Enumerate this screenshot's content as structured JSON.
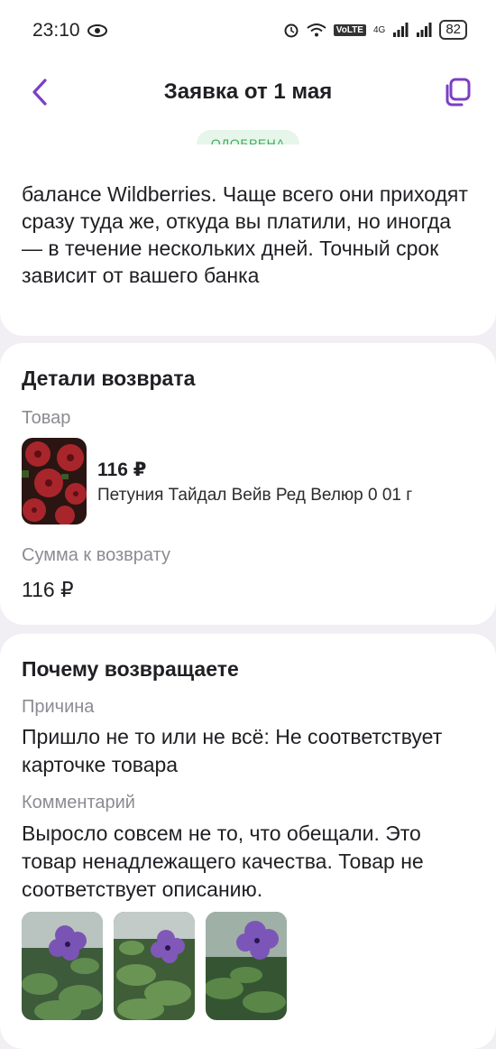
{
  "status_bar": {
    "time": "23:10",
    "battery": "82",
    "network": "4G",
    "volte": "VoLTE"
  },
  "header": {
    "title": "Заявка от 1 мая",
    "status_badge": "ОДОБРЕНА"
  },
  "info": {
    "text": "балансе Wildberries. Чаще всего они приходят сразу туда же, откуда вы платили, но иногда — в течение нескольких дней. Точный срок зависит от вашего банка"
  },
  "details": {
    "title": "Детали возврата",
    "product_label": "Товар",
    "product_price": "116 ₽",
    "product_name": "Петуния Тайдал Вейв Ред Велюр 0 01 г",
    "amount_label": "Сумма к возврату",
    "amount_value": "116 ₽"
  },
  "reason": {
    "title": "Почему возвращаете",
    "reason_label": "Причина",
    "reason_value": "Пришло не то или не всё: Не соответствует карточке товара",
    "comment_label": "Комментарий",
    "comment_value": "Выросло совсем не то, что обещали. Это товар ненадлежащего качества. Товар не соответствует описанию."
  },
  "colors": {
    "accent": "#7b3fc4",
    "badge_bg": "#e7f6ea",
    "badge_text": "#3fae5b"
  }
}
